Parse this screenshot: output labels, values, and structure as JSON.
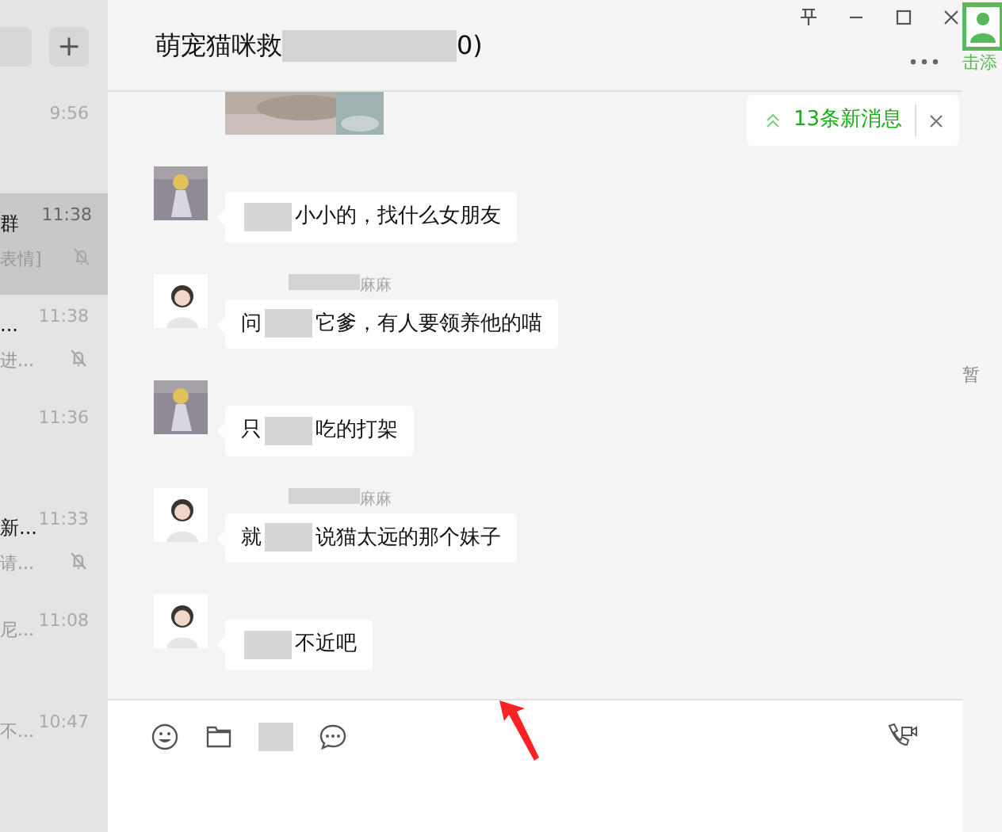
{
  "sidebar": {
    "add_button": "+",
    "chats": [
      {
        "time": "9:56",
        "muted": false,
        "selected": false
      },
      {
        "name": "群",
        "preview": "表情]",
        "time": "11:38",
        "muted": true,
        "selected": true
      },
      {
        "name": "...",
        "preview": "进...",
        "time": "11:38",
        "muted": true,
        "selected": false
      },
      {
        "time": "11:36",
        "muted": false,
        "selected": false
      },
      {
        "name": "新...",
        "preview": "请...",
        "time": "11:33",
        "muted": true,
        "selected": false
      },
      {
        "preview": "尼...",
        "time": "11:08",
        "muted": false,
        "selected": false
      },
      {
        "preview": "不...",
        "time": "10:47",
        "muted": false,
        "selected": false
      }
    ]
  },
  "window_controls": [
    {
      "kind": "pin"
    },
    {
      "kind": "minimize"
    },
    {
      "kind": "maximize"
    },
    {
      "kind": "close"
    }
  ],
  "chat": {
    "title": "萌宠猫咪救",
    "title_tail": "0)",
    "new_messages": "13条新消息",
    "messages": [
      {
        "text_end": "小小的，找什么女朋友"
      },
      {
        "avatar": {
          "kind": "cartoon"
        },
        "sender": "麻麻",
        "text_start": "问",
        "text_end": "它爹，有人要领养他的喵"
      },
      {
        "text_start": "只",
        "text_end": "吃的打架"
      },
      {
        "avatar": {
          "kind": "cartoon"
        },
        "sender": "麻麻",
        "text_start": "就",
        "text_end": "说猫太远的那个妹子"
      },
      {
        "avatar": {
          "kind": "cartoon"
        },
        "text_end": "不近吧"
      }
    ]
  },
  "right_panel": {
    "add_label": "击添",
    "empty_label": "暂"
  }
}
